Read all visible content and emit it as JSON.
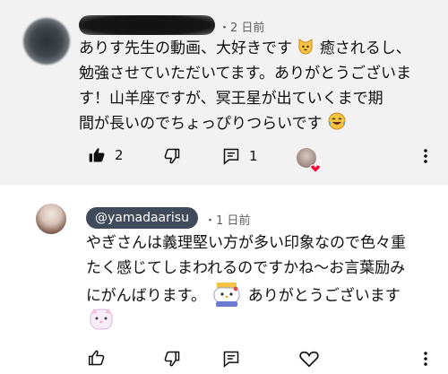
{
  "comment1": {
    "author": "",
    "time": "・2 日前",
    "lines": [
      "ありす先生の動画、大好きです",
      "癒されるし、",
      "勉強させていただいてます。ありがとうございま",
      "す！山羊座ですが、冥王星が出ていくまで期",
      "間が長いのでちょっぴりつらいです"
    ],
    "likes": "2",
    "replies": "1"
  },
  "comment2": {
    "author": "@yamadaarisu",
    "time": "・1 日前",
    "lines": [
      "やぎさんは義理堅い方が多い印象なので色々重",
      "たく感じてしまわれるのですかね〜お言葉励み",
      "にがんばります。",
      "ありがとうございます"
    ]
  },
  "icons": {
    "like": "thumb-up-icon",
    "dislike": "thumb-down-icon",
    "reply": "reply-icon",
    "more": "more-vert-icon",
    "heart": "heart-icon"
  },
  "colors": {
    "pill": "#3f4b5a",
    "heart": "#ff0033",
    "meta": "#606060"
  }
}
